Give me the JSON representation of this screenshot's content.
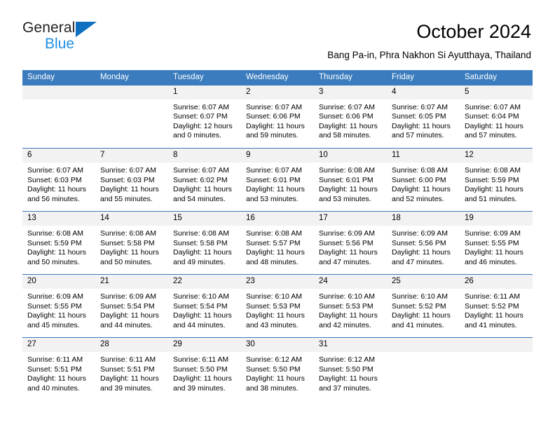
{
  "brand": {
    "name_top": "General",
    "name_bottom": "Blue",
    "triangle_color": "#0f6fc0",
    "text_color_top": "#231f20",
    "text_color_bottom": "#1f8fe0"
  },
  "header": {
    "title": "October 2024",
    "subtitle": "Bang Pa-in, Phra Nakhon Si Ayutthaya, Thailand"
  },
  "theme": {
    "header_blue": "#3a7cbe",
    "daynum_bg": "#f2f2f2",
    "text": "#000000"
  },
  "weekday_headers": [
    "Sunday",
    "Monday",
    "Tuesday",
    "Wednesday",
    "Thursday",
    "Friday",
    "Saturday"
  ],
  "weeks": [
    [
      {
        "day": "",
        "lines": []
      },
      {
        "day": "",
        "lines": []
      },
      {
        "day": "1",
        "lines": [
          "Sunrise: 6:07 AM",
          "Sunset: 6:07 PM",
          "Daylight: 12 hours",
          "and 0 minutes."
        ]
      },
      {
        "day": "2",
        "lines": [
          "Sunrise: 6:07 AM",
          "Sunset: 6:06 PM",
          "Daylight: 11 hours",
          "and 59 minutes."
        ]
      },
      {
        "day": "3",
        "lines": [
          "Sunrise: 6:07 AM",
          "Sunset: 6:06 PM",
          "Daylight: 11 hours",
          "and 58 minutes."
        ]
      },
      {
        "day": "4",
        "lines": [
          "Sunrise: 6:07 AM",
          "Sunset: 6:05 PM",
          "Daylight: 11 hours",
          "and 57 minutes."
        ]
      },
      {
        "day": "5",
        "lines": [
          "Sunrise: 6:07 AM",
          "Sunset: 6:04 PM",
          "Daylight: 11 hours",
          "and 57 minutes."
        ]
      }
    ],
    [
      {
        "day": "6",
        "lines": [
          "Sunrise: 6:07 AM",
          "Sunset: 6:03 PM",
          "Daylight: 11 hours",
          "and 56 minutes."
        ]
      },
      {
        "day": "7",
        "lines": [
          "Sunrise: 6:07 AM",
          "Sunset: 6:03 PM",
          "Daylight: 11 hours",
          "and 55 minutes."
        ]
      },
      {
        "day": "8",
        "lines": [
          "Sunrise: 6:07 AM",
          "Sunset: 6:02 PM",
          "Daylight: 11 hours",
          "and 54 minutes."
        ]
      },
      {
        "day": "9",
        "lines": [
          "Sunrise: 6:07 AM",
          "Sunset: 6:01 PM",
          "Daylight: 11 hours",
          "and 53 minutes."
        ]
      },
      {
        "day": "10",
        "lines": [
          "Sunrise: 6:08 AM",
          "Sunset: 6:01 PM",
          "Daylight: 11 hours",
          "and 53 minutes."
        ]
      },
      {
        "day": "11",
        "lines": [
          "Sunrise: 6:08 AM",
          "Sunset: 6:00 PM",
          "Daylight: 11 hours",
          "and 52 minutes."
        ]
      },
      {
        "day": "12",
        "lines": [
          "Sunrise: 6:08 AM",
          "Sunset: 5:59 PM",
          "Daylight: 11 hours",
          "and 51 minutes."
        ]
      }
    ],
    [
      {
        "day": "13",
        "lines": [
          "Sunrise: 6:08 AM",
          "Sunset: 5:59 PM",
          "Daylight: 11 hours",
          "and 50 minutes."
        ]
      },
      {
        "day": "14",
        "lines": [
          "Sunrise: 6:08 AM",
          "Sunset: 5:58 PM",
          "Daylight: 11 hours",
          "and 50 minutes."
        ]
      },
      {
        "day": "15",
        "lines": [
          "Sunrise: 6:08 AM",
          "Sunset: 5:58 PM",
          "Daylight: 11 hours",
          "and 49 minutes."
        ]
      },
      {
        "day": "16",
        "lines": [
          "Sunrise: 6:08 AM",
          "Sunset: 5:57 PM",
          "Daylight: 11 hours",
          "and 48 minutes."
        ]
      },
      {
        "day": "17",
        "lines": [
          "Sunrise: 6:09 AM",
          "Sunset: 5:56 PM",
          "Daylight: 11 hours",
          "and 47 minutes."
        ]
      },
      {
        "day": "18",
        "lines": [
          "Sunrise: 6:09 AM",
          "Sunset: 5:56 PM",
          "Daylight: 11 hours",
          "and 47 minutes."
        ]
      },
      {
        "day": "19",
        "lines": [
          "Sunrise: 6:09 AM",
          "Sunset: 5:55 PM",
          "Daylight: 11 hours",
          "and 46 minutes."
        ]
      }
    ],
    [
      {
        "day": "20",
        "lines": [
          "Sunrise: 6:09 AM",
          "Sunset: 5:55 PM",
          "Daylight: 11 hours",
          "and 45 minutes."
        ]
      },
      {
        "day": "21",
        "lines": [
          "Sunrise: 6:09 AM",
          "Sunset: 5:54 PM",
          "Daylight: 11 hours",
          "and 44 minutes."
        ]
      },
      {
        "day": "22",
        "lines": [
          "Sunrise: 6:10 AM",
          "Sunset: 5:54 PM",
          "Daylight: 11 hours",
          "and 44 minutes."
        ]
      },
      {
        "day": "23",
        "lines": [
          "Sunrise: 6:10 AM",
          "Sunset: 5:53 PM",
          "Daylight: 11 hours",
          "and 43 minutes."
        ]
      },
      {
        "day": "24",
        "lines": [
          "Sunrise: 6:10 AM",
          "Sunset: 5:53 PM",
          "Daylight: 11 hours",
          "and 42 minutes."
        ]
      },
      {
        "day": "25",
        "lines": [
          "Sunrise: 6:10 AM",
          "Sunset: 5:52 PM",
          "Daylight: 11 hours",
          "and 41 minutes."
        ]
      },
      {
        "day": "26",
        "lines": [
          "Sunrise: 6:11 AM",
          "Sunset: 5:52 PM",
          "Daylight: 11 hours",
          "and 41 minutes."
        ]
      }
    ],
    [
      {
        "day": "27",
        "lines": [
          "Sunrise: 6:11 AM",
          "Sunset: 5:51 PM",
          "Daylight: 11 hours",
          "and 40 minutes."
        ]
      },
      {
        "day": "28",
        "lines": [
          "Sunrise: 6:11 AM",
          "Sunset: 5:51 PM",
          "Daylight: 11 hours",
          "and 39 minutes."
        ]
      },
      {
        "day": "29",
        "lines": [
          "Sunrise: 6:11 AM",
          "Sunset: 5:50 PM",
          "Daylight: 11 hours",
          "and 39 minutes."
        ]
      },
      {
        "day": "30",
        "lines": [
          "Sunrise: 6:12 AM",
          "Sunset: 5:50 PM",
          "Daylight: 11 hours",
          "and 38 minutes."
        ]
      },
      {
        "day": "31",
        "lines": [
          "Sunrise: 6:12 AM",
          "Sunset: 5:50 PM",
          "Daylight: 11 hours",
          "and 37 minutes."
        ]
      },
      {
        "day": "",
        "lines": []
      },
      {
        "day": "",
        "lines": []
      }
    ]
  ]
}
